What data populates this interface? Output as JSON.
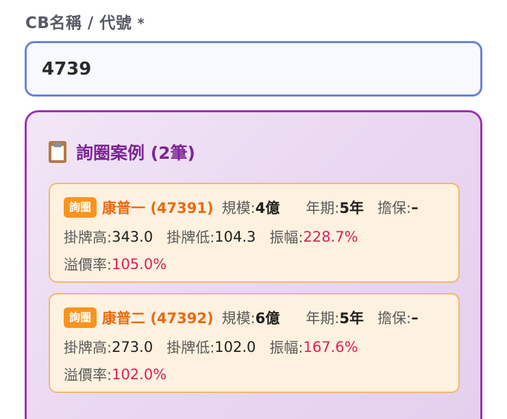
{
  "field": {
    "label": "CB名稱 / 代號",
    "required_mark": "*",
    "value": "4739"
  },
  "panel": {
    "icon": "clipboard-icon",
    "title": "詢圈案例 (2筆)"
  },
  "cases": [
    {
      "badge": "詢圈",
      "name": "康普一 (47391)",
      "scale_label": "規模:",
      "scale_value": "4億",
      "term_label": "年期:",
      "term_value": "5年",
      "guarantee_label": "擔保:",
      "guarantee_value": "–",
      "high_label": "掛牌高:",
      "high_value": "343.0",
      "low_label": "掛牌低:",
      "low_value": "104.3",
      "amp_label": "振幅:",
      "amp_value": "228.7%",
      "premium_label": "溢價率:",
      "premium_value": "105.0%"
    },
    {
      "badge": "詢圈",
      "name": "康普二 (47392)",
      "scale_label": "規模:",
      "scale_value": "6億",
      "term_label": "年期:",
      "term_value": "5年",
      "guarantee_label": "擔保:",
      "guarantee_value": "–",
      "high_label": "掛牌高:",
      "high_value": "273.0",
      "low_label": "掛牌低:",
      "low_value": "102.0",
      "amp_label": "振幅:",
      "amp_value": "167.6%",
      "premium_label": "溢價率:",
      "premium_value": "102.0%"
    }
  ],
  "colors": {
    "input_border": "#6a7fdc",
    "panel_border": "#9b30b5",
    "panel_title": "#7d2596",
    "badge": "#f7941d",
    "bond_name": "#ea6a10",
    "highlight": "#e01f58",
    "card_border": "#f2b870",
    "card_bg": "#fdf1df"
  }
}
